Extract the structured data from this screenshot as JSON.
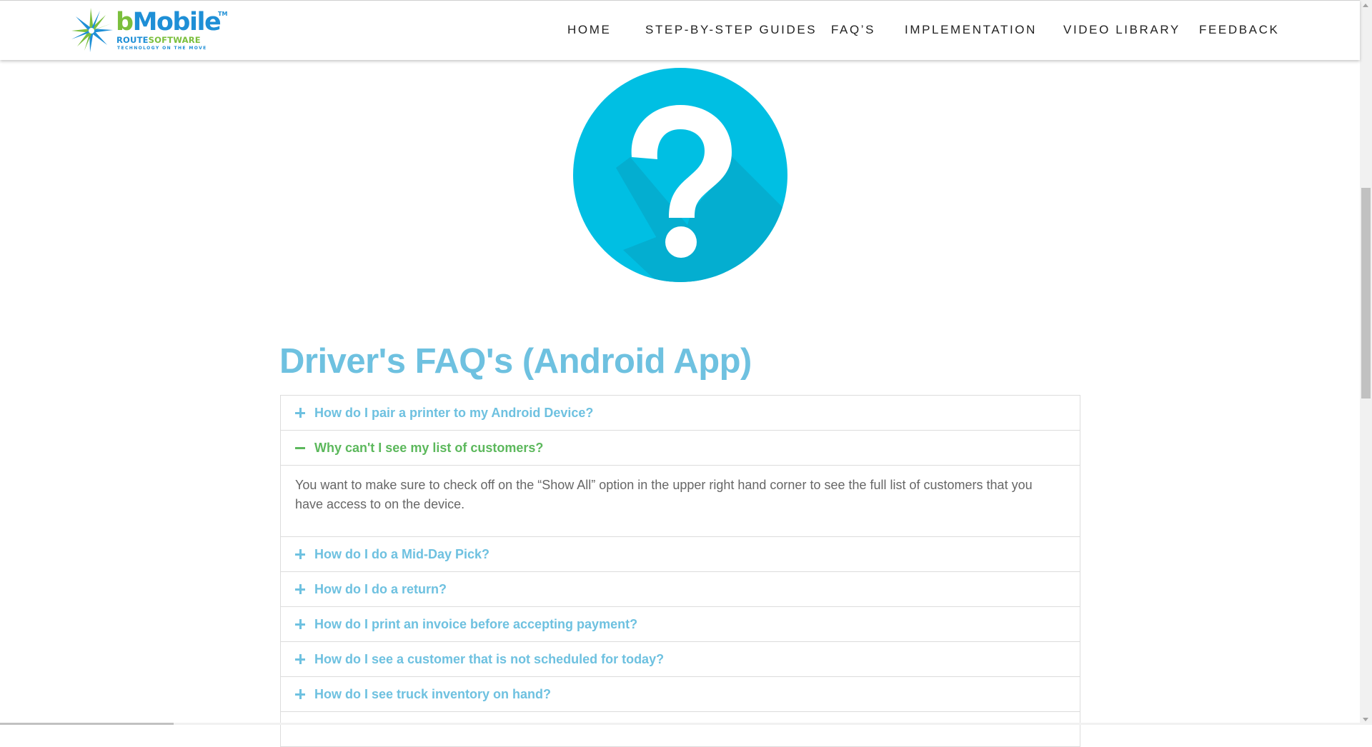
{
  "header": {
    "logo": {
      "brand_b": "b",
      "brand_mobile": "Mobile",
      "trademark": "TM",
      "route": "ROUTE",
      "software": "SOFTWARE",
      "tagline": "TECHNOLOGY ON THE MOVE"
    },
    "nav": [
      {
        "label": "HOME"
      },
      {
        "label": "STEP-BY-STEP GUIDES"
      },
      {
        "label": "FAQ’S"
      },
      {
        "label": "IMPLEMENTATION"
      },
      {
        "label": "VIDEO LIBRARY"
      },
      {
        "label": "FEEDBACK"
      }
    ]
  },
  "hero": {
    "icon": "question-mark-icon",
    "color": "#00bfe3"
  },
  "page_title": "Driver's FAQ's (Android App)",
  "faq": [
    {
      "question": "How do I pair a printer to my Android Device?",
      "expanded": false
    },
    {
      "question": "Why can't I see my list of customers?",
      "expanded": true,
      "answer": "You want to make sure to check off on the “Show All” option in the upper right hand corner to see the full list of customers that you have access to on the device."
    },
    {
      "question": "How do I do a Mid-Day Pick?",
      "expanded": false
    },
    {
      "question": "How do I do a return?",
      "expanded": false
    },
    {
      "question": "How do I print an invoice before accepting payment?",
      "expanded": false
    },
    {
      "question": "How do I see a customer that is not scheduled for today?",
      "expanded": false
    },
    {
      "question": "How do I see truck inventory on hand?",
      "expanded": false
    }
  ],
  "colors": {
    "accent": "#6ec1e0",
    "active": "#5cb85c",
    "body_text": "#666666",
    "nav_text": "#222222",
    "brand_blue": "#1e8fd6",
    "brand_green": "#7bbf3d"
  }
}
